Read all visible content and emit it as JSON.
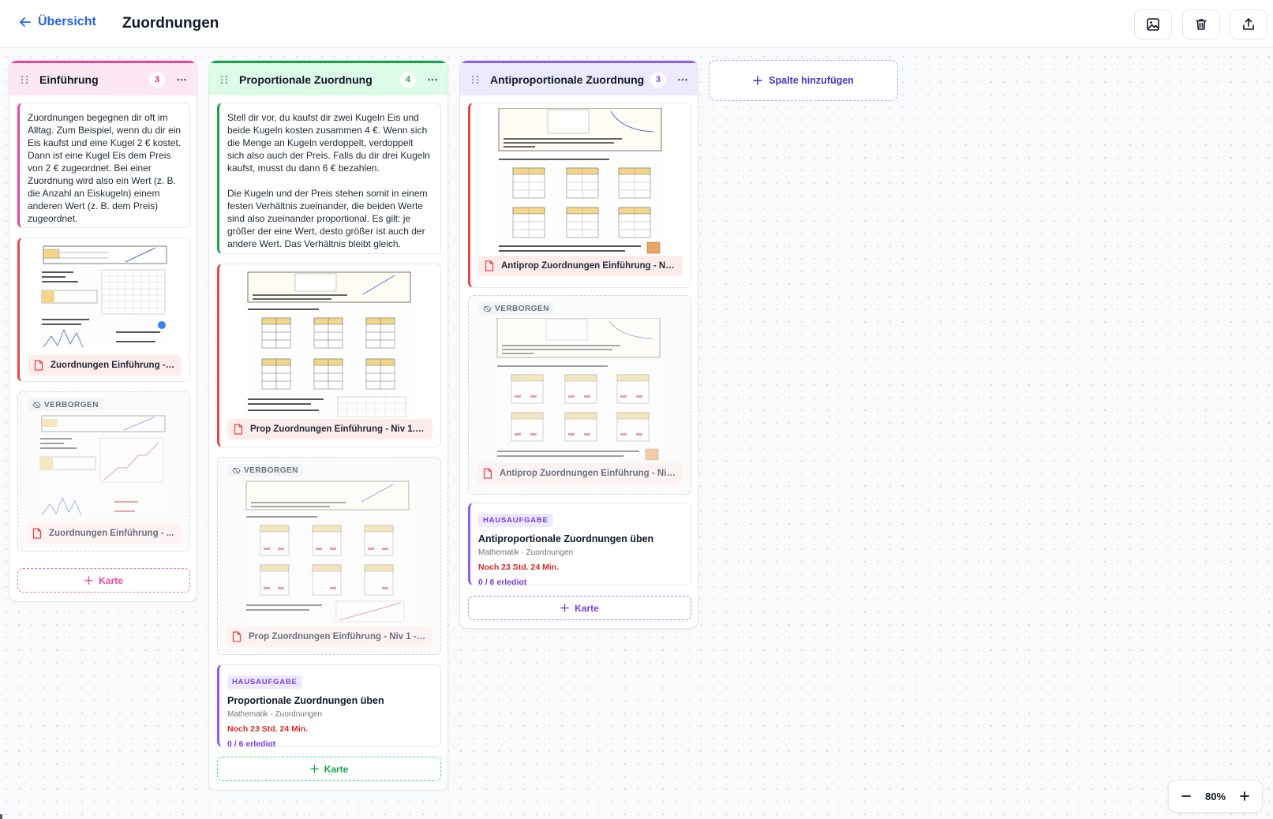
{
  "header": {
    "back_label": "Übersicht",
    "title": "Zuordnungen",
    "tools": [
      "image-icon",
      "trash-icon",
      "share-icon"
    ]
  },
  "columns": [
    {
      "title": "Einführung",
      "count": "3",
      "accent": "#ec4899",
      "head_bg": "#fce7f3",
      "text_card": "Zuordnungen begegnen dir oft im Alltag. Zum Beispiel, wenn du dir ein Eis kaufst und eine Kugel 2 € kostet. Dann ist eine Kugel Eis dem Preis von 2 € zugeordnet. Bei einer Zuordnung wird also ein Wert (z. B. die Anzahl an Eiskugeln)  einem anderen Wert (z. B. dem Preis) zugeordnet.",
      "file_card": "Zuordnungen Einführung - ...",
      "hidden_card": {
        "badge": "VERBORGEN",
        "file": "Zuordnungen Einführung - ..."
      },
      "add_label": "Karte"
    },
    {
      "title": "Proportionale Zuordnung",
      "count": "4",
      "accent": "#16a34a",
      "head_bg": "#dcfce7",
      "text_card": "Stell dir vor, du kaufst dir zwei Kugeln Eis und beide Kugeln kosten zusammen 4 €. Wenn sich die Menge an Kugeln verdoppelt, verdoppelt sich also auch der Preis. Falls du dir drei Kugeln kaufst, musst du dann 6 € bezahlen.\n\nDie Kugeln und der Preis stehen somit in einem festen Verhältnis zueinander, die beiden Werte sind also zueinander proportional. Es gilt: je größer der eine Wert, desto größer ist auch der andere Wert. Das Verhältnis bleibt gleich.",
      "file_card": "Prop Zuordnungen Einführung - Niv 1.pdf",
      "hidden_card": {
        "badge": "VERBORGEN",
        "file": "Prop Zuordnungen Einführung - Niv 1 - ..."
      },
      "homework": {
        "tag": "HAUSAUFGABE",
        "title": "Proportionale Zuordnungen üben",
        "meta": "Mathematik · Zuordnungen",
        "due": "Noch 23 Std. 24 Min.",
        "progress": "0 / 6 erledigt"
      },
      "add_label": "Karte"
    },
    {
      "title": "Antiproportionale Zuordnung",
      "count": "3",
      "accent": "#8b5cf6",
      "head_bg": "#ede9fe",
      "file_card": "Antiprop Zuordnungen Einführung - Niv...",
      "hidden_card": {
        "badge": "VERBORGEN",
        "file": "Antiprop Zuordnungen Einführung - Niv..."
      },
      "homework": {
        "tag": "HAUSAUFGABE",
        "title": "Antiproportionale Zuordnungen üben",
        "meta": "Mathematik · Zuordnungen",
        "due": "Noch 23 Std. 24 Min.",
        "progress": "0 / 6 erledigt"
      },
      "add_label": "Karte"
    }
  ],
  "add_column_label": "Spalte hinzufügen",
  "zoom": {
    "value": "80%"
  }
}
